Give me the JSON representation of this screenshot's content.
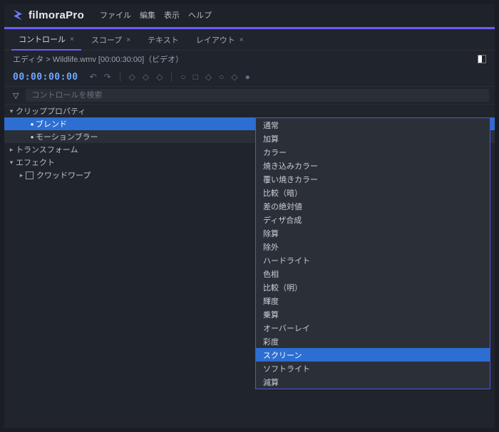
{
  "app": {
    "brand_a": "filmora",
    "brand_b": "Pro"
  },
  "menubar": {
    "file": "ファイル",
    "edit": "編集",
    "view": "表示",
    "help": "ヘルプ"
  },
  "tabs": {
    "controls": "コントロール",
    "scope": "スコープ",
    "text": "テキスト",
    "layout": "レイアウト"
  },
  "crumb": "エディタ > Wildlife.wmv [00:00:30:00]（ビデオ）",
  "timecode": "00:00:00:00",
  "search": {
    "placeholder": "コントロールを検索"
  },
  "tree": {
    "clip_props": "クリッププロパティ",
    "blend": "ブレンド",
    "blend_value": "スクリーン",
    "motion_blur": "モーションブラー",
    "transform": "トランスフォーム",
    "effects": "エフェクト",
    "quad_warp": "クワッドワープ"
  },
  "blend_options": [
    "通常",
    "加算",
    "カラー",
    "焼き込みカラー",
    "覆い焼きカラー",
    "比較（暗）",
    "差の絶対値",
    "ディザ合成",
    "除算",
    "除外",
    "ハードライト",
    "色相",
    "比較（明）",
    "輝度",
    "乗算",
    "オーバーレイ",
    "彩度",
    "スクリーン",
    "ソフトライト",
    "減算"
  ],
  "blend_selected_index": 17
}
